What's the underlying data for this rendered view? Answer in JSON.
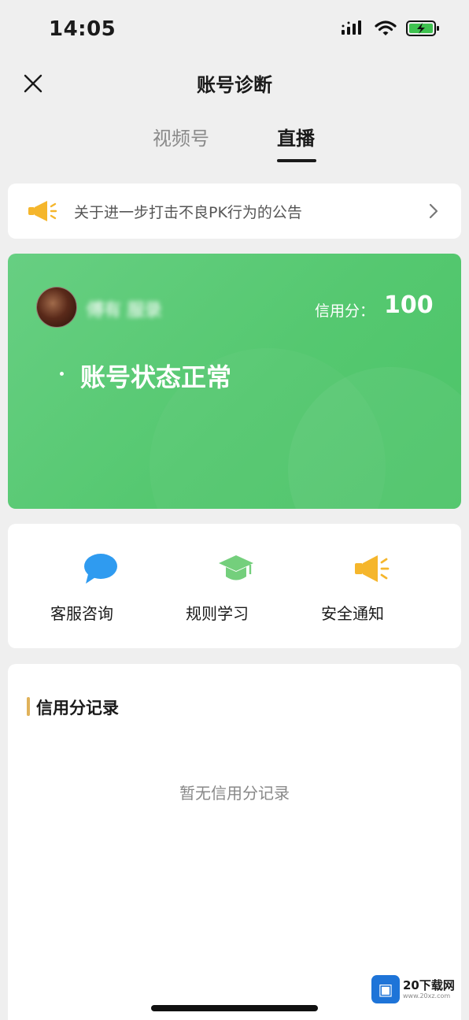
{
  "status_bar": {
    "time": "14:05",
    "icons": [
      "signal-icon",
      "wifi-icon",
      "battery-charging-icon"
    ]
  },
  "header": {
    "title": "账号诊断",
    "close_icon": "close-icon"
  },
  "tabs": [
    {
      "label": "视频号",
      "active": false
    },
    {
      "label": "直播",
      "active": true
    }
  ],
  "notice": {
    "icon": "megaphone-icon",
    "text": "关于进一步打击不良PK行为的公告",
    "chevron_icon": "chevron-right-icon"
  },
  "account_card": {
    "username": "傅有 服录",
    "credit_label": "信用分：",
    "credit_score": "100",
    "status_text": "账号状态正常",
    "background_color": "#5bca74"
  },
  "quick_actions": [
    {
      "label": "客服咨询",
      "icon": "chat-bubble-icon",
      "color": "#2f9bf0"
    },
    {
      "label": "规则学习",
      "icon": "graduation-cap-icon",
      "color": "#74cf7c"
    },
    {
      "label": "安全通知",
      "icon": "megaphone-icon",
      "color": "#f5b62c"
    }
  ],
  "credit_records": {
    "title": "信用分记录",
    "empty_text": "暂无信用分记录",
    "accent_color": "#e0b25a"
  },
  "watermark": {
    "logo_text": "▣",
    "main_text": "20下载网",
    "sub_text": "www.20xz.com"
  }
}
